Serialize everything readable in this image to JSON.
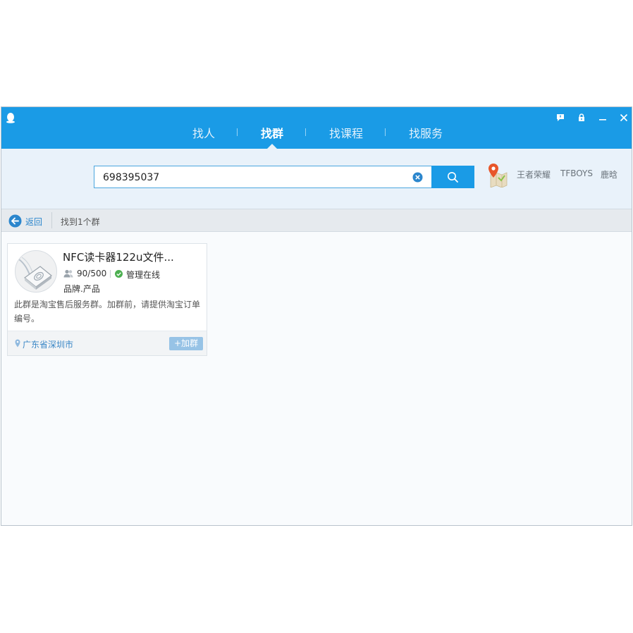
{
  "nav": {
    "tabs": [
      {
        "label": "找人"
      },
      {
        "label": "找群",
        "active": true
      },
      {
        "label": "找课程"
      },
      {
        "label": "找服务"
      }
    ]
  },
  "window_controls": [
    "feedback-icon",
    "lock-icon",
    "minimize-icon",
    "close-icon"
  ],
  "search": {
    "value": "698395037",
    "clear_icon": "clear-circle-x-icon",
    "button_icon": "search-icon"
  },
  "hot_tags": [
    "王者荣耀",
    "TFBOYS",
    "鹿晗"
  ],
  "status": {
    "back_label": "返回",
    "result_text": "找到1个群"
  },
  "results": [
    {
      "name": "NFC读卡器122u文件...",
      "members": "90/500",
      "admin_status": "管理在线",
      "tags": "品牌.产品",
      "description": "此群是淘宝售后服务群。加群前，请提供淘宝订单编号。",
      "location": "广东省深圳市",
      "join_label": "+加群"
    }
  ],
  "colors": {
    "titlebar": "#1a9be6",
    "search_band": "#e9f2fa",
    "link": "#2b86cd",
    "join_button": "#97c3e6",
    "online_green": "#4caf50"
  }
}
